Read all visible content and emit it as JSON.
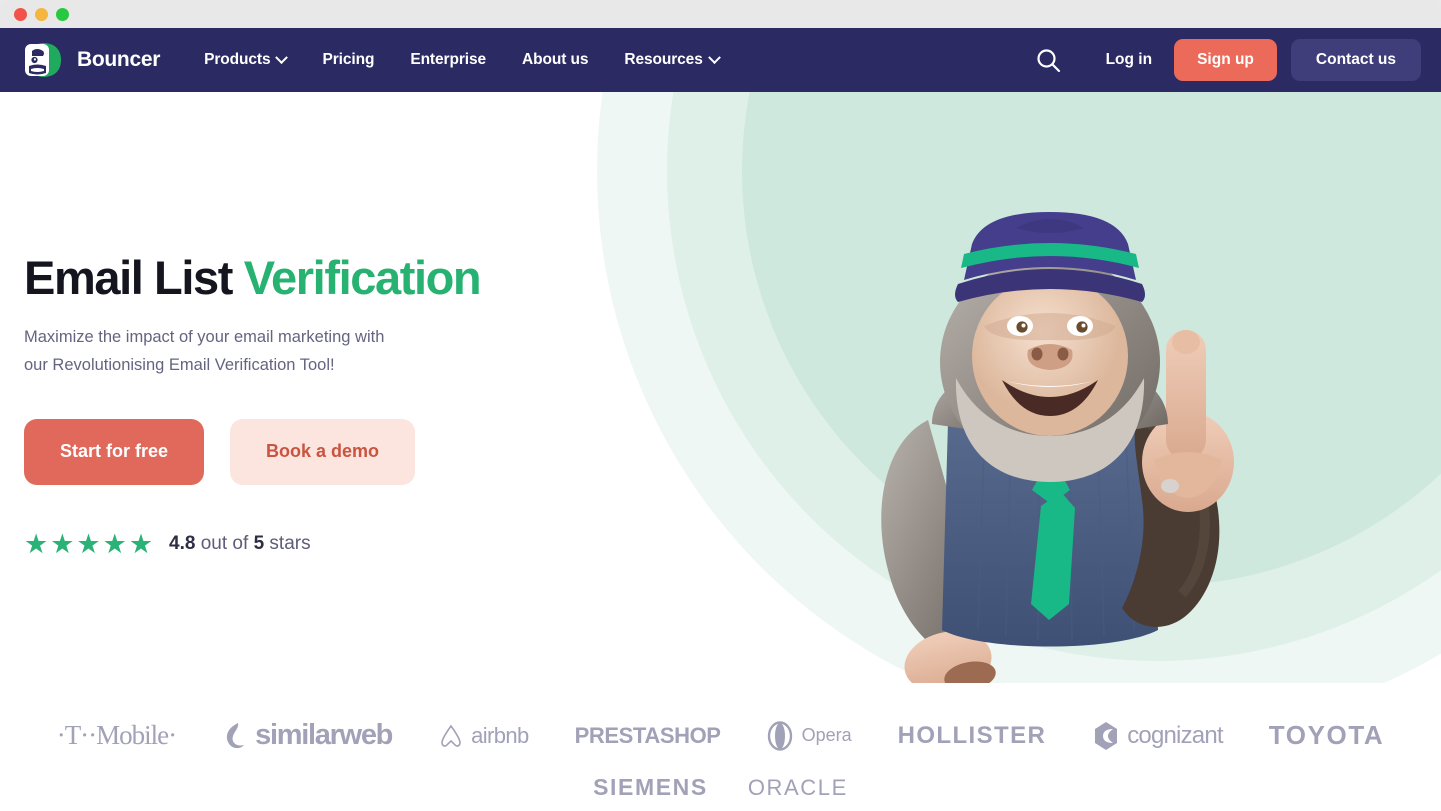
{
  "window": {
    "traffic_lights": [
      "close",
      "minimize",
      "maximize"
    ]
  },
  "navbar": {
    "brand_name": "Bouncer",
    "brand_icon": "bouncer-gorilla-logo",
    "links": [
      {
        "label": "Products",
        "has_dropdown": true
      },
      {
        "label": "Pricing",
        "has_dropdown": false
      },
      {
        "label": "Enterprise",
        "has_dropdown": false
      },
      {
        "label": "About us",
        "has_dropdown": false
      },
      {
        "label": "Resources",
        "has_dropdown": true
      }
    ],
    "search_icon": "search-icon",
    "login_label": "Log in",
    "signup_label": "Sign up",
    "contact_label": "Contact us",
    "background_color": "#2b2a63",
    "signup_color": "#ec6a5a",
    "contact_color": "#403e7a"
  },
  "hero": {
    "headline_primary": "Email List",
    "headline_accent": "Verification",
    "subheadline_line1": "Maximize the impact of your email marketing with",
    "subheadline_line2": "our Revolutionising Email Verification Tool!",
    "primary_cta": "Start for free",
    "secondary_cta": "Book a demo",
    "accent_color": "#27b272",
    "primary_cta_color": "#e0695c",
    "secondary_cta_color": "#fce4df",
    "rating": {
      "stars_filled": 5,
      "stars_glyph": "★★★★★",
      "score": "4.8",
      "middle_text": "out of",
      "max": "5",
      "suffix": "stars",
      "star_color": "#2bb277"
    },
    "illustration": "gorilla-mascot-pointing-up"
  },
  "logos": {
    "row1": [
      {
        "name": "t-mobile",
        "text": "·T··Mobile·",
        "style": "lg-tmobile"
      },
      {
        "name": "similarweb",
        "text": "similarweb",
        "style": "lg-similarweb"
      },
      {
        "name": "airbnb",
        "text": "airbnb",
        "style": "lg-airbnb"
      },
      {
        "name": "prestashop",
        "text": "PRESTASHOP",
        "style": "lg-prestashop"
      },
      {
        "name": "opera",
        "text": "Opera",
        "style": "lg-opera"
      },
      {
        "name": "hollister",
        "text": "HOLLISTER",
        "style": "lg-hollister"
      },
      {
        "name": "cognizant",
        "text": "cognizant",
        "style": "lg-cognizant"
      },
      {
        "name": "toyota",
        "text": "TOYOTA",
        "style": "lg-toyota"
      }
    ],
    "row2": [
      {
        "name": "siemens",
        "text": "SIEMENS",
        "style": "lg-siemens"
      },
      {
        "name": "oracle",
        "text": "ORACLE",
        "style": "lg-oracle"
      }
    ],
    "color": "#9c9cb4"
  }
}
